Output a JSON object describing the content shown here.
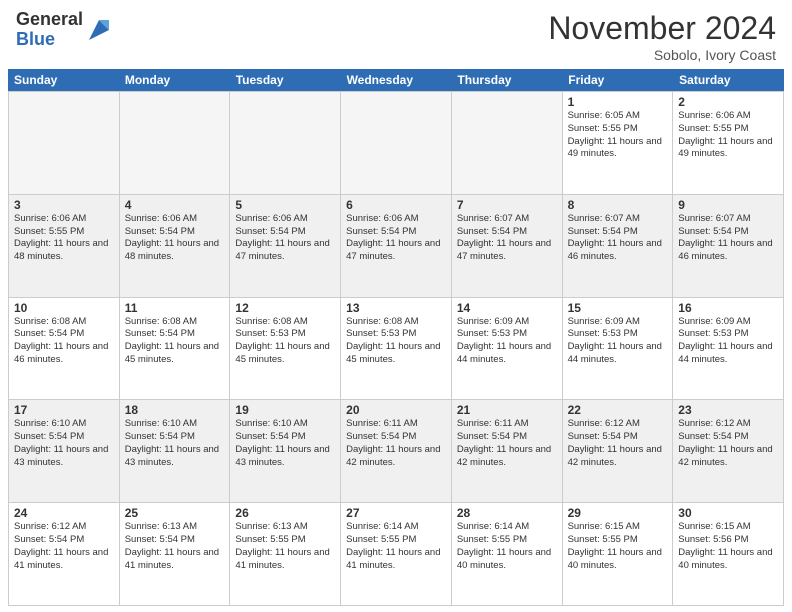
{
  "header": {
    "logo_general": "General",
    "logo_blue": "Blue",
    "month_title": "November 2024",
    "location": "Sobolo, Ivory Coast"
  },
  "calendar": {
    "days_of_week": [
      "Sunday",
      "Monday",
      "Tuesday",
      "Wednesday",
      "Thursday",
      "Friday",
      "Saturday"
    ],
    "weeks": [
      [
        {
          "day": "",
          "empty": true
        },
        {
          "day": "",
          "empty": true
        },
        {
          "day": "",
          "empty": true
        },
        {
          "day": "",
          "empty": true
        },
        {
          "day": "",
          "empty": true
        },
        {
          "day": "1",
          "sunrise": "Sunrise: 6:05 AM",
          "sunset": "Sunset: 5:55 PM",
          "daylight": "Daylight: 11 hours and 49 minutes."
        },
        {
          "day": "2",
          "sunrise": "Sunrise: 6:06 AM",
          "sunset": "Sunset: 5:55 PM",
          "daylight": "Daylight: 11 hours and 49 minutes."
        }
      ],
      [
        {
          "day": "3",
          "sunrise": "Sunrise: 6:06 AM",
          "sunset": "Sunset: 5:55 PM",
          "daylight": "Daylight: 11 hours and 48 minutes."
        },
        {
          "day": "4",
          "sunrise": "Sunrise: 6:06 AM",
          "sunset": "Sunset: 5:54 PM",
          "daylight": "Daylight: 11 hours and 48 minutes."
        },
        {
          "day": "5",
          "sunrise": "Sunrise: 6:06 AM",
          "sunset": "Sunset: 5:54 PM",
          "daylight": "Daylight: 11 hours and 47 minutes."
        },
        {
          "day": "6",
          "sunrise": "Sunrise: 6:06 AM",
          "sunset": "Sunset: 5:54 PM",
          "daylight": "Daylight: 11 hours and 47 minutes."
        },
        {
          "day": "7",
          "sunrise": "Sunrise: 6:07 AM",
          "sunset": "Sunset: 5:54 PM",
          "daylight": "Daylight: 11 hours and 47 minutes."
        },
        {
          "day": "8",
          "sunrise": "Sunrise: 6:07 AM",
          "sunset": "Sunset: 5:54 PM",
          "daylight": "Daylight: 11 hours and 46 minutes."
        },
        {
          "day": "9",
          "sunrise": "Sunrise: 6:07 AM",
          "sunset": "Sunset: 5:54 PM",
          "daylight": "Daylight: 11 hours and 46 minutes."
        }
      ],
      [
        {
          "day": "10",
          "sunrise": "Sunrise: 6:08 AM",
          "sunset": "Sunset: 5:54 PM",
          "daylight": "Daylight: 11 hours and 46 minutes."
        },
        {
          "day": "11",
          "sunrise": "Sunrise: 6:08 AM",
          "sunset": "Sunset: 5:54 PM",
          "daylight": "Daylight: 11 hours and 45 minutes."
        },
        {
          "day": "12",
          "sunrise": "Sunrise: 6:08 AM",
          "sunset": "Sunset: 5:53 PM",
          "daylight": "Daylight: 11 hours and 45 minutes."
        },
        {
          "day": "13",
          "sunrise": "Sunrise: 6:08 AM",
          "sunset": "Sunset: 5:53 PM",
          "daylight": "Daylight: 11 hours and 45 minutes."
        },
        {
          "day": "14",
          "sunrise": "Sunrise: 6:09 AM",
          "sunset": "Sunset: 5:53 PM",
          "daylight": "Daylight: 11 hours and 44 minutes."
        },
        {
          "day": "15",
          "sunrise": "Sunrise: 6:09 AM",
          "sunset": "Sunset: 5:53 PM",
          "daylight": "Daylight: 11 hours and 44 minutes."
        },
        {
          "day": "16",
          "sunrise": "Sunrise: 6:09 AM",
          "sunset": "Sunset: 5:53 PM",
          "daylight": "Daylight: 11 hours and 44 minutes."
        }
      ],
      [
        {
          "day": "17",
          "sunrise": "Sunrise: 6:10 AM",
          "sunset": "Sunset: 5:54 PM",
          "daylight": "Daylight: 11 hours and 43 minutes."
        },
        {
          "day": "18",
          "sunrise": "Sunrise: 6:10 AM",
          "sunset": "Sunset: 5:54 PM",
          "daylight": "Daylight: 11 hours and 43 minutes."
        },
        {
          "day": "19",
          "sunrise": "Sunrise: 6:10 AM",
          "sunset": "Sunset: 5:54 PM",
          "daylight": "Daylight: 11 hours and 43 minutes."
        },
        {
          "day": "20",
          "sunrise": "Sunrise: 6:11 AM",
          "sunset": "Sunset: 5:54 PM",
          "daylight": "Daylight: 11 hours and 42 minutes."
        },
        {
          "day": "21",
          "sunrise": "Sunrise: 6:11 AM",
          "sunset": "Sunset: 5:54 PM",
          "daylight": "Daylight: 11 hours and 42 minutes."
        },
        {
          "day": "22",
          "sunrise": "Sunrise: 6:12 AM",
          "sunset": "Sunset: 5:54 PM",
          "daylight": "Daylight: 11 hours and 42 minutes."
        },
        {
          "day": "23",
          "sunrise": "Sunrise: 6:12 AM",
          "sunset": "Sunset: 5:54 PM",
          "daylight": "Daylight: 11 hours and 42 minutes."
        }
      ],
      [
        {
          "day": "24",
          "sunrise": "Sunrise: 6:12 AM",
          "sunset": "Sunset: 5:54 PM",
          "daylight": "Daylight: 11 hours and 41 minutes."
        },
        {
          "day": "25",
          "sunrise": "Sunrise: 6:13 AM",
          "sunset": "Sunset: 5:54 PM",
          "daylight": "Daylight: 11 hours and 41 minutes."
        },
        {
          "day": "26",
          "sunrise": "Sunrise: 6:13 AM",
          "sunset": "Sunset: 5:55 PM",
          "daylight": "Daylight: 11 hours and 41 minutes."
        },
        {
          "day": "27",
          "sunrise": "Sunrise: 6:14 AM",
          "sunset": "Sunset: 5:55 PM",
          "daylight": "Daylight: 11 hours and 41 minutes."
        },
        {
          "day": "28",
          "sunrise": "Sunrise: 6:14 AM",
          "sunset": "Sunset: 5:55 PM",
          "daylight": "Daylight: 11 hours and 40 minutes."
        },
        {
          "day": "29",
          "sunrise": "Sunrise: 6:15 AM",
          "sunset": "Sunset: 5:55 PM",
          "daylight": "Daylight: 11 hours and 40 minutes."
        },
        {
          "day": "30",
          "sunrise": "Sunrise: 6:15 AM",
          "sunset": "Sunset: 5:56 PM",
          "daylight": "Daylight: 11 hours and 40 minutes."
        }
      ]
    ]
  }
}
